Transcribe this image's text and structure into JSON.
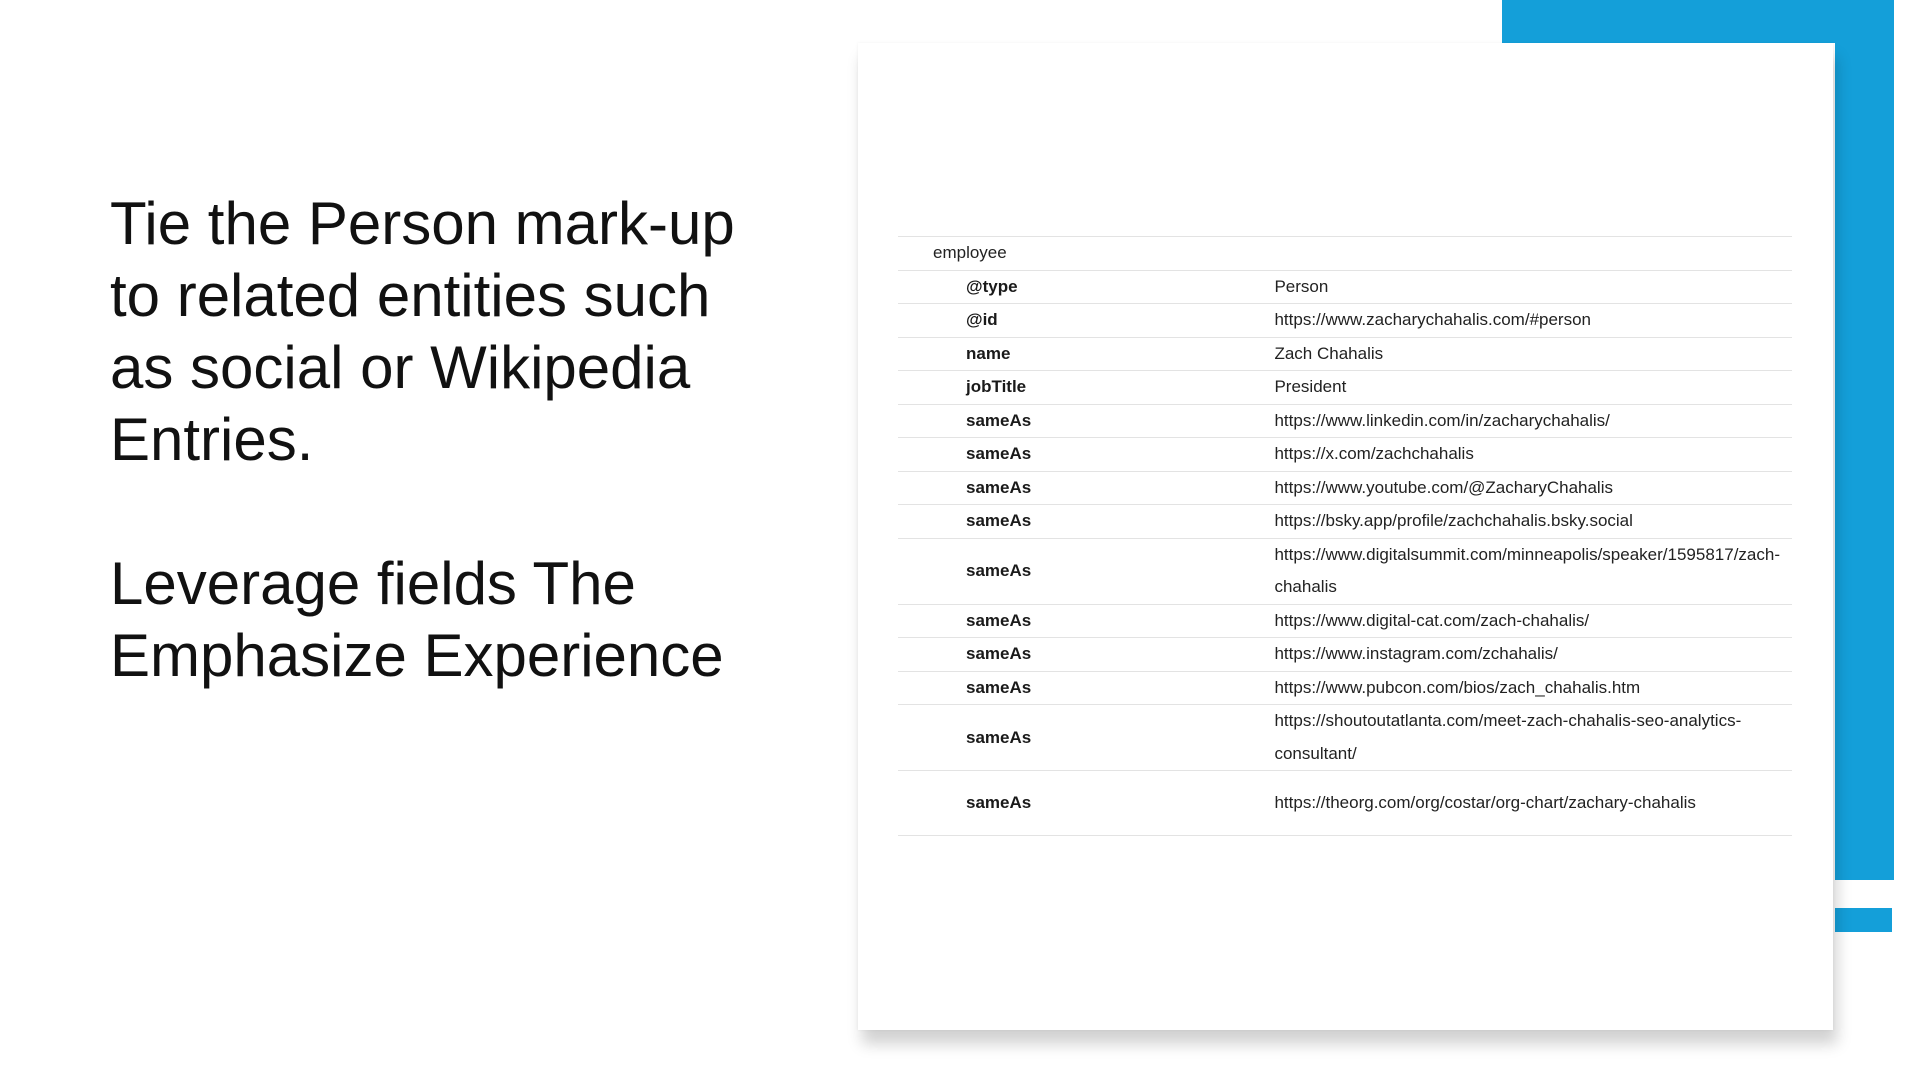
{
  "slide": {
    "heading_lines": [
      "Tie the Person mark-up",
      "to related entities such",
      "as social or Wikipedia",
      "Entries."
    ],
    "subheading_lines": [
      "Leverage fields The",
      "Emphasize Experience"
    ]
  },
  "colors": {
    "accent_blue": "#149fd9"
  },
  "table": {
    "section_label": "employee",
    "rows": [
      {
        "key": "@type",
        "value": "Person"
      },
      {
        "key": "@id",
        "value": "https://www.zacharychahalis.com/#person"
      },
      {
        "key": "name",
        "value": "Zach Chahalis"
      },
      {
        "key": "jobTitle",
        "value": "President"
      },
      {
        "key": "sameAs",
        "value": "https://www.linkedin.com/in/zacharychahalis/"
      },
      {
        "key": "sameAs",
        "value": "https://x.com/zachchahalis"
      },
      {
        "key": "sameAs",
        "value": "https://www.youtube.com/@ZacharyChahalis"
      },
      {
        "key": "sameAs",
        "value": "https://bsky.app/profile/zachchahalis.bsky.social"
      },
      {
        "key": "sameAs",
        "value": "https://www.digitalsummit.com/minneapolis/speaker/1595817/zach-chahalis"
      },
      {
        "key": "sameAs",
        "value": "https://www.digital-cat.com/zach-chahalis/"
      },
      {
        "key": "sameAs",
        "value": "https://www.instagram.com/zchahalis/"
      },
      {
        "key": "sameAs",
        "value": "https://www.pubcon.com/bios/zach_chahalis.htm"
      },
      {
        "key": "sameAs",
        "value": "https://shoutoutatlanta.com/meet-zach-chahalis-seo-analytics-consultant/"
      },
      {
        "key": "sameAs",
        "value": "https://theorg.com/org/costar/org-chart/zachary-chahalis"
      }
    ]
  }
}
